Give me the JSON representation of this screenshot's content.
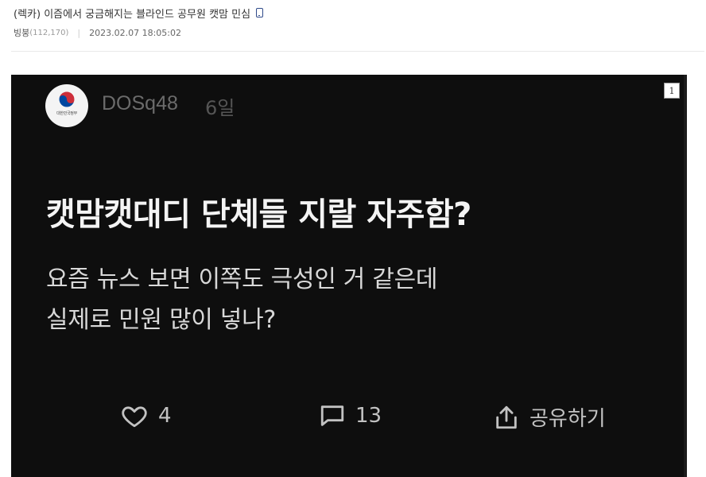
{
  "post": {
    "title": "(렉카) 이즘에서 궁금해지는 블라인드 공무원 캣맘 민심",
    "author": "빙붕",
    "author_points": "(112,170)",
    "separator": "|",
    "date": "2023.02.07 18:05:02"
  },
  "image_index": "1",
  "card": {
    "avatar_text": "대한민국정부",
    "username": "DOSq48",
    "time_ago": "6일",
    "headline": "캣맘캣대디 단체들 지랄 자주함?",
    "body_lines": [
      "요즘 뉴스 보면 이쪽도 극성인 거 같은데",
      "실제로 민원 많이 넣나?"
    ],
    "likes": "4",
    "comments": "13",
    "share_label": "공유하기"
  },
  "icons": [
    "mobile-icon",
    "taegeuk-icon",
    "heart-icon",
    "comment-icon",
    "share-icon"
  ],
  "colors": {
    "card_background": "#0e0e0e",
    "mobile_icon": "#2f4a8a",
    "taegeuk_red": "#cd2e3a",
    "taegeuk_blue": "#0047a0"
  }
}
